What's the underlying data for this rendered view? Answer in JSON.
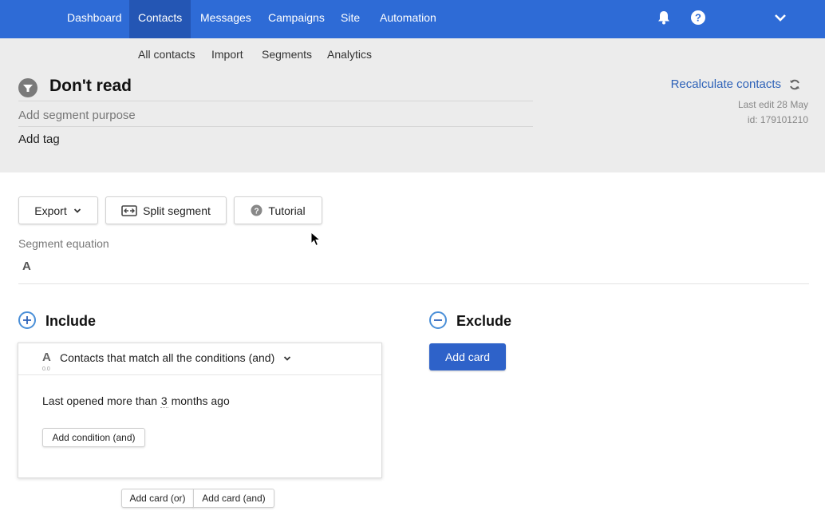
{
  "nav": {
    "items": [
      "Dashboard",
      "Contacts",
      "Messages",
      "Campaigns",
      "Site",
      "Automation"
    ],
    "active": "Contacts",
    "icons": [
      "bell-icon",
      "help-icon",
      "chevron-down-icon"
    ]
  },
  "subnav": {
    "items": [
      "All contacts",
      "Import",
      "Segments",
      "Analytics"
    ]
  },
  "segment": {
    "title": "Don't read",
    "purpose_placeholder": "Add segment purpose",
    "add_tag": "Add tag",
    "recalculate": "Recalculate contacts",
    "last_edit": "Last edit 28 May",
    "id": "id:  179101210"
  },
  "toolbar": {
    "export": "Export",
    "split": "Split segment",
    "tutorial": "Tutorial"
  },
  "equation": {
    "label": "Segment equation",
    "value": "A"
  },
  "include": {
    "title": "Include",
    "card": {
      "letter": "A",
      "letter_sub": "0.0",
      "title": "Contacts that match all the conditions (and)",
      "condition_prefix": "Last opened  more than",
      "condition_value": "3",
      "condition_suffix": "months ago",
      "add_condition": "Add condition (and)"
    },
    "add_card_or": "Add card (or)",
    "add_card_and": "Add card (and)"
  },
  "exclude": {
    "title": "Exclude",
    "add_card": "Add card"
  },
  "colors": {
    "nav": "#2e6bd6",
    "nav_active": "#2456b4",
    "primary": "#2e62c9",
    "link": "#2e62b8",
    "header_bg": "#ececec"
  }
}
